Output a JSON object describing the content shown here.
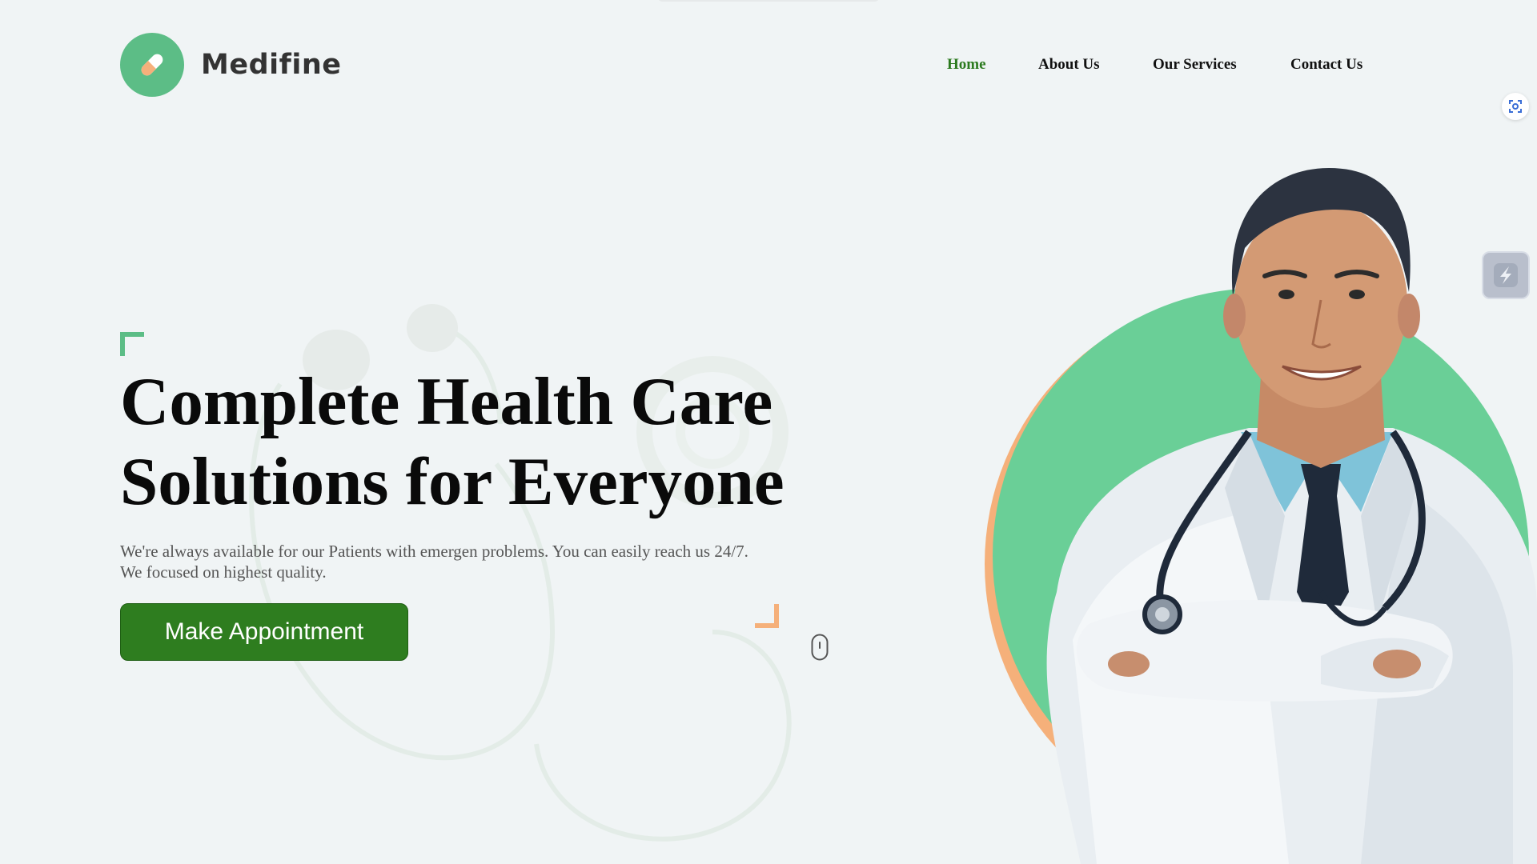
{
  "brand": {
    "name": "Medifine",
    "icon": "pill-icon"
  },
  "nav": {
    "items": [
      {
        "label": "Home",
        "active": true
      },
      {
        "label": "About Us",
        "active": false
      },
      {
        "label": "Our Services",
        "active": false
      },
      {
        "label": "Contact Us",
        "active": false
      }
    ]
  },
  "hero": {
    "title_line1": "Complete Health Care",
    "title_line2": "Solutions for Everyone",
    "desc_line1": "We're always available for our Patients with emergen problems. You can easily reach us 24/7.",
    "desc_line2": "We focused on highest quality.",
    "cta_label": "Make Appointment",
    "scroll_icon": "mouse-scroll-icon"
  },
  "image": {
    "subject": "doctor-photo"
  },
  "widgets": {
    "scan_icon": "screenshot-scan-icon",
    "side_icon": "lightning-icon"
  },
  "colors": {
    "background": "#f0f4f5",
    "brand_green": "#5cbd86",
    "nav_active": "#2b7a1e",
    "cta_green": "#2e7d1f",
    "accent_orange": "#f5b07a"
  }
}
